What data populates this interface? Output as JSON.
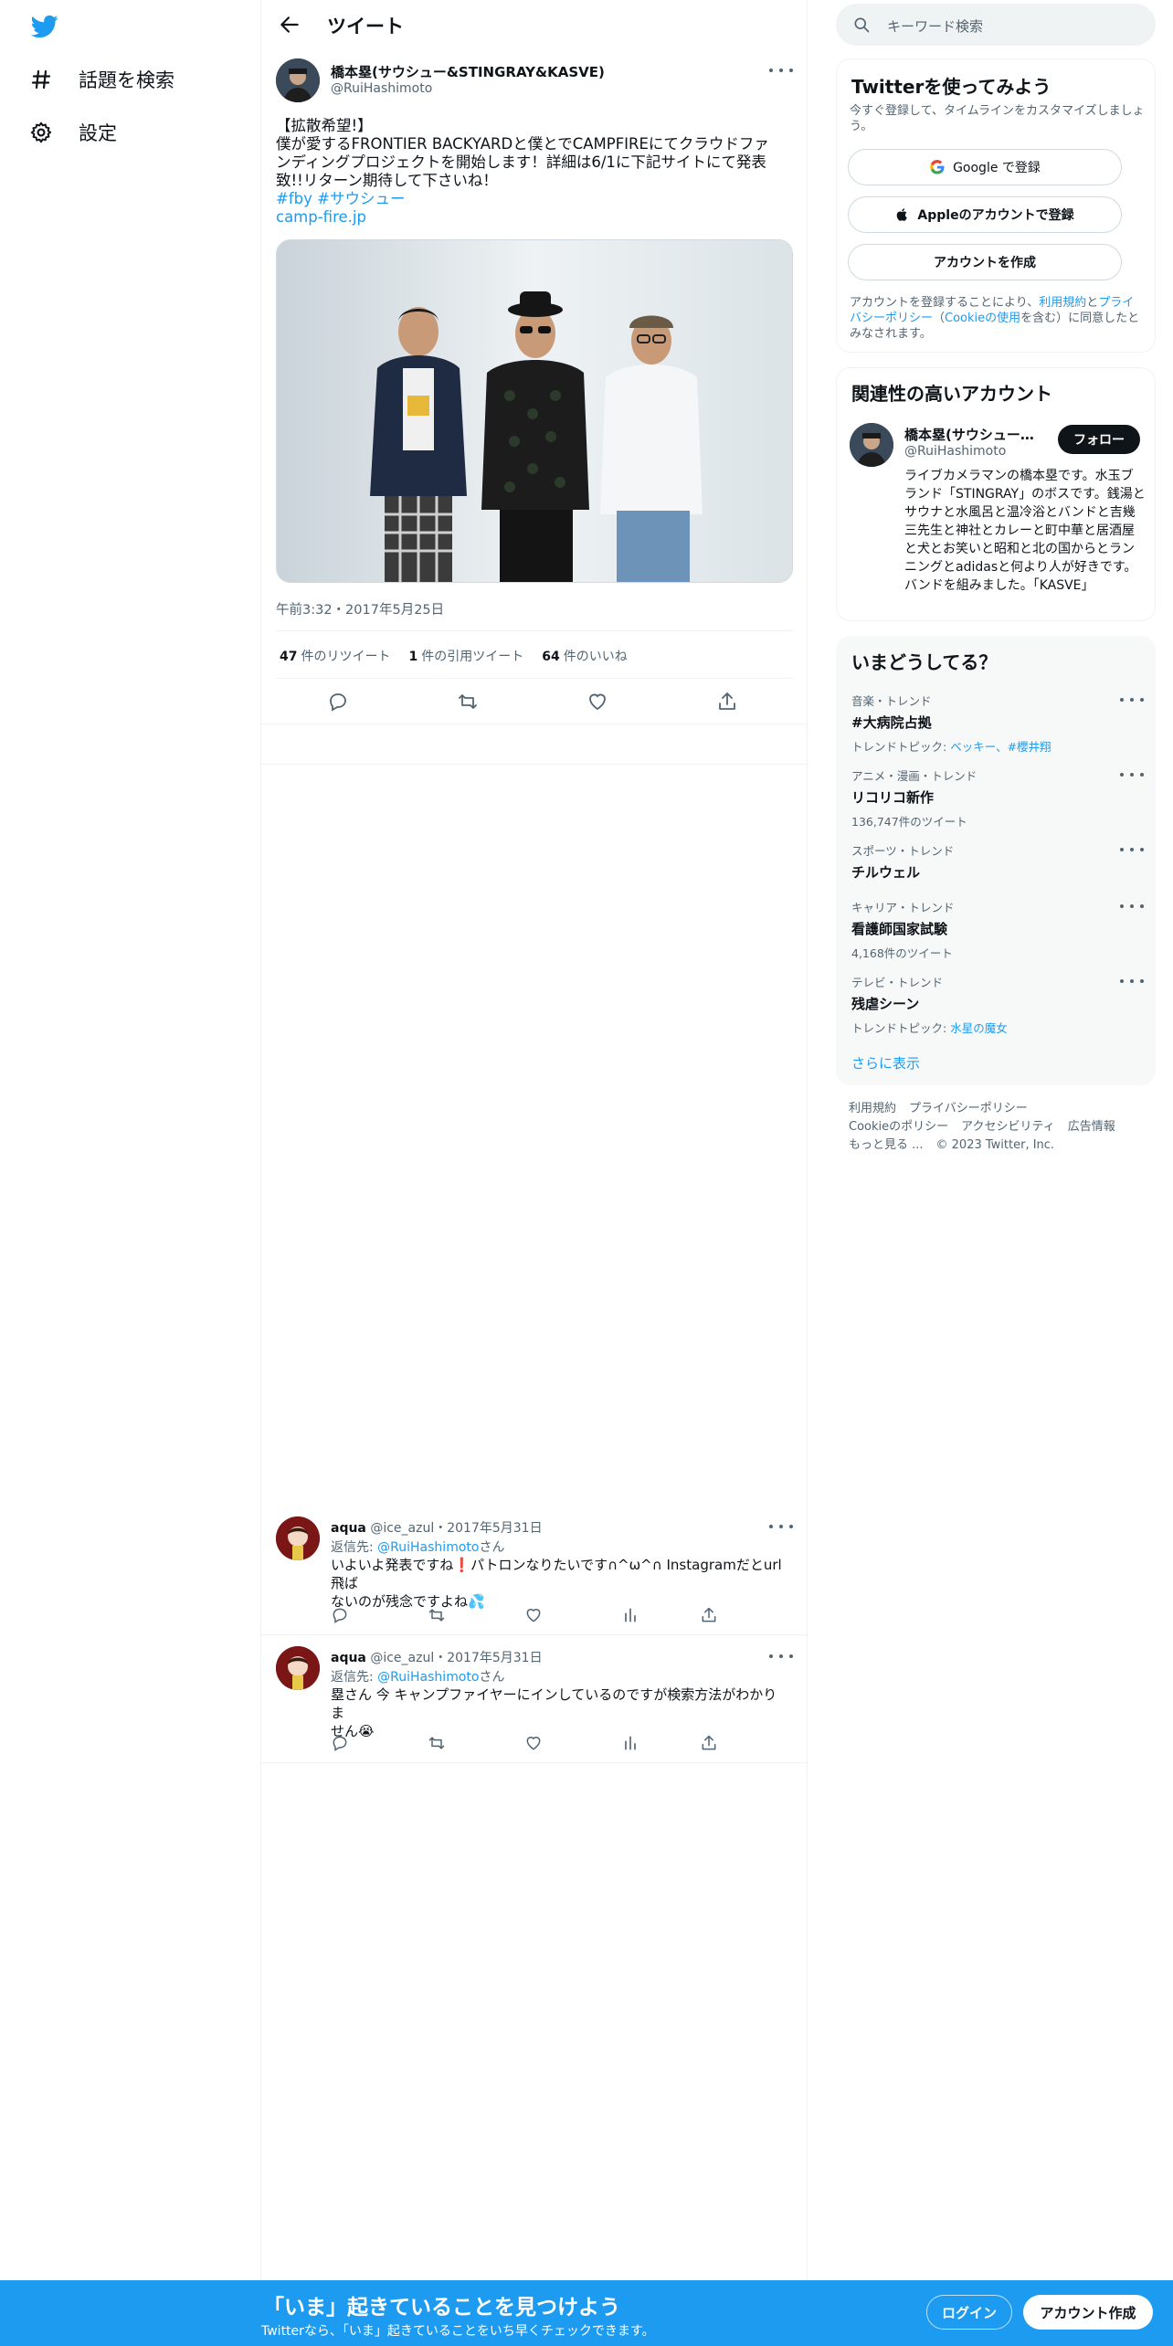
{
  "nav": {
    "logo": "twitter-bird",
    "items": [
      {
        "label": "話題を検索",
        "icon": "hashtag-icon"
      },
      {
        "label": "設定",
        "icon": "gear-icon"
      }
    ]
  },
  "main": {
    "header_title": "ツイート",
    "tweet": {
      "author_name": "橋本塁(サウシュー&STINGRAY&KASVE)",
      "author_handle": "@RuiHashimoto",
      "text_lines": [
        "【拡散希望!】",
        "僕が愛するFRONTIER BACKYARDと僕とでCAMPFIREにてクラウドファ",
        "ンディングプロジェクトを開始します！詳細は6/1に下記サイトにて発表",
        "致!!リターン期待して下さいね！"
      ],
      "hashtags": [
        "#fby",
        "#サウシュー"
      ],
      "link": "camp-fire.jp",
      "timestamp": "午前3:32・2017年5月25日",
      "stats": {
        "retweets_count": "47",
        "retweets_label": "件のリツイート",
        "quotes_count": "1",
        "quotes_label": "件の引用ツイート",
        "likes_count": "64",
        "likes_label": "件のいいね"
      }
    },
    "replies": [
      {
        "name": "aqua",
        "handle": "@ice_azul",
        "date": "・2017年5月31日",
        "reply_to_prefix": "返信先: ",
        "reply_to_handle": "@RuiHashimoto",
        "reply_to_suffix": "さん",
        "text_lines": [
          "いよいよ発表ですね❗️パトロンなりたいです∩^ω^∩ Instagramだとurl飛ば",
          "ないのが残念ですよね💦"
        ]
      },
      {
        "name": "aqua",
        "handle": "@ice_azul",
        "date": "・2017年5月31日",
        "reply_to_prefix": "返信先: ",
        "reply_to_handle": "@RuiHashimoto",
        "reply_to_suffix": "さん",
        "text_lines": [
          "塁さん 今 キャンプファイヤーにインしているのですが検索方法がわかりま",
          "せん😭"
        ]
      }
    ]
  },
  "right": {
    "search_placeholder": "キーワード検索",
    "signup_card": {
      "title": "Twitterを使ってみよう",
      "subtitle": "今すぐ登録して、タイムラインをカスタマイズしましょう。",
      "google_button": "Google で登録",
      "apple_button": "Appleのアカウントで登録",
      "create_button": "アカウントを作成",
      "legal_line1_prefix": "アカウントを登録することにより、",
      "legal_link_terms": "利用規約",
      "legal_and": "と",
      "legal_link_privacy_a": "プライ",
      "legal_link_privacy_b": "バシーポリシー",
      "legal_paren_open": "（",
      "legal_link_cookie": "Cookieの使用",
      "legal_suffix": "を含む）に同意したとみなされます。"
    },
    "related": {
      "title": "関連性の高いアカウント",
      "name": "橋本塁(サウシュー&...",
      "handle": "@RuiHashimoto",
      "follow_label": "フォロー",
      "bio": "ライブカメラマンの橋本塁です。水玉ブランド「STINGRAY」のボスです。銭湯とサウナと水風呂と温冷浴とバンドと吉幾三先生と神社とカレーと町中華と居酒屋と犬とお笑いと昭和と北の国からとランニングとadidasと何より人が好きです。バンドを組みました。「KASVE」"
    },
    "trends": {
      "title": "いまどうしてる？",
      "items": [
        {
          "category": "音楽・トレンド",
          "name": "#大病院占拠",
          "meta_prefix": "トレンドトピック: ",
          "meta_links": "ベッキー、#櫻井翔"
        },
        {
          "category": "アニメ・漫画・トレンド",
          "name": "リコリコ新作",
          "meta_prefix": "136,747件のツイート",
          "meta_links": ""
        },
        {
          "category": "スポーツ・トレンド",
          "name": "チルウェル",
          "meta_prefix": "",
          "meta_links": ""
        },
        {
          "category": "キャリア・トレンド",
          "name": "看護師国家試験",
          "meta_prefix": "4,168件のツイート",
          "meta_links": ""
        },
        {
          "category": "テレビ・トレンド",
          "name": "残虐シーン",
          "meta_prefix": "トレンドトピック: ",
          "meta_links": "水星の魔女"
        }
      ],
      "show_more": "さらに表示"
    },
    "footer": {
      "row1": [
        "利用規約",
        "プライバシーポリシー"
      ],
      "row2": [
        "Cookieのポリシー",
        "アクセシビリティ",
        "広告情報"
      ],
      "row3": [
        "もっと見る ...",
        "© 2023 Twitter, Inc."
      ]
    }
  },
  "bottom_bar": {
    "title": "「いま」起きていることを見つけよう",
    "subtitle": "Twitterなら、「いま」起きていることをいち早くチェックできます。",
    "login_label": "ログイン",
    "signup_label": "アカウント作成"
  },
  "colors": {
    "accent": "#1d9bf0",
    "text": "#0f1419",
    "muted": "#536471"
  }
}
